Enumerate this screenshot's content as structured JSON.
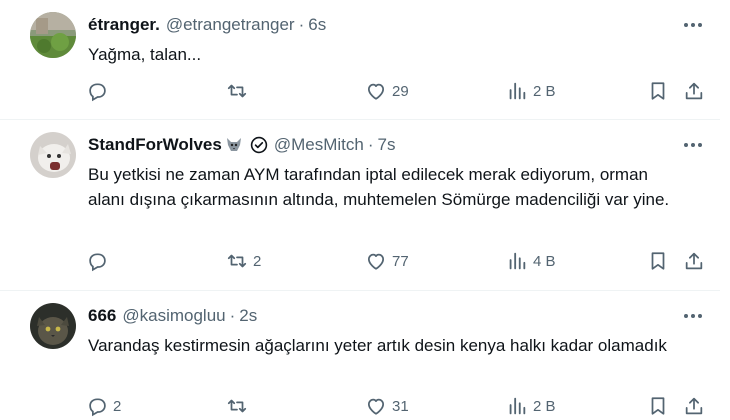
{
  "tweets": [
    {
      "name": "étranger.",
      "handle": "@etrangetranger",
      "time": "6s",
      "text": "Yağma, talan...",
      "reply_count": "",
      "retweet_count": "",
      "like_count": "29",
      "view_count": "2 B",
      "avatar": "photo-avatar-green-field"
    },
    {
      "name": "StandForWolves",
      "handle": "@MesMitch",
      "time": "7s",
      "text": "Bu yetkisi ne zaman AYM tarafından iptal edilecek merak ediyorum, orman alanı dışına çıkarmasının altında, muhtemelen Sömürge madenciliği var yine.",
      "reply_count": "",
      "retweet_count": "2",
      "like_count": "77",
      "view_count": "4 B",
      "avatar": "photo-avatar-wolf",
      "badges": [
        "wolf-emoji-icon",
        "verified-check-icon"
      ]
    },
    {
      "name": "666",
      "handle": "@kasimogluu",
      "time": "2s",
      "text": "Varandaş kestirmesin ağaçlarını yeter artık desin kenya halkı kadar olamadık",
      "reply_count": "2",
      "retweet_count": "",
      "like_count": "31",
      "view_count": "2 B",
      "avatar": "photo-avatar-cat"
    }
  ],
  "separator": "·",
  "colors": {
    "text_primary": "#0f1419",
    "text_secondary": "#536471",
    "divider": "#eff3f4",
    "background": "#ffffff"
  },
  "icons": [
    "reply-icon",
    "retweet-icon",
    "like-icon",
    "views-icon",
    "bookmark-icon",
    "share-icon",
    "more-icon"
  ]
}
